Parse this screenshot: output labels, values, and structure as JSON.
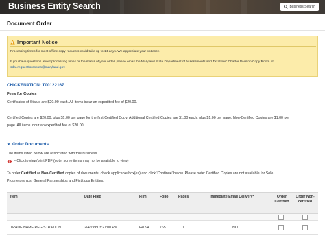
{
  "header": {
    "title": "Business Entity Search",
    "search_button_label": "Business Search"
  },
  "page_title": "Document Order",
  "notice": {
    "heading": "Important Notice",
    "line1": "Processing times for most offline copy requests could take up to 14 days. We appreciate your patience.",
    "line2": "If you have questions about processing times or the status of your order, please email the Maryland State Department of Assessments and Taxations' Charter Division Copy Room at",
    "email": "sdat.requestforcopies@maryland.gov."
  },
  "check_number": "CHICKENATION: T00122167",
  "fees": {
    "heading": "Fees for Copies",
    "line1": "Certificates of Status are $20.00 each. All items incur an expedited fee of $20.00.",
    "line2": "Certified Copies are $20.00, plus $1.00 per page for the first Certified Copy. Additional Certified Copies are $1.00 each, plus $1.00 per page. Non-Certified Copies are $1.00 per",
    "line3": "page. All items incur an expedited fee of $20.00."
  },
  "order_documents": {
    "label": "Order Documents",
    "intro": "The items listed below are associated with this business.",
    "view_hint": "– Click to view/print PDF (note: some items may not be available to view)",
    "instr_line1_pre": "To order ",
    "instr_certified": "Certified",
    "instr_or": " or ",
    "instr_noncertified": "Non-Certified",
    "instr_line1_post": " copies of documents, check applicable box(es) and click 'Continue' below. Please note: Certified Copies are not available for Sole",
    "instr_line2": "Proprietorships, General Partnerships and Fictitious Entities."
  },
  "table": {
    "columns": {
      "item": "Item",
      "date_filed": "Date Filed",
      "film": "Film",
      "folio": "Folio",
      "pages": "Pages",
      "email_delivery": "Immediate Email Delivery*",
      "order_certified": "Order Certified",
      "order_noncertified": "Order Non-certified"
    },
    "rows": [
      {
        "item": "TRADE NAME REGISTRATION",
        "date_filed": "2/4/1999 3:27:00 PM",
        "film": "F4094",
        "folio": "765",
        "pages": "1",
        "email_delivery": "NO",
        "order_certified": false,
        "order_noncertified": false
      }
    ]
  },
  "colors": {
    "accent_link": "#1a5aa8",
    "notice_bg": "#fcecaa",
    "notice_border": "#e9d278",
    "warning_icon": "#e8a21a",
    "eye_icon": "#d0312d"
  }
}
